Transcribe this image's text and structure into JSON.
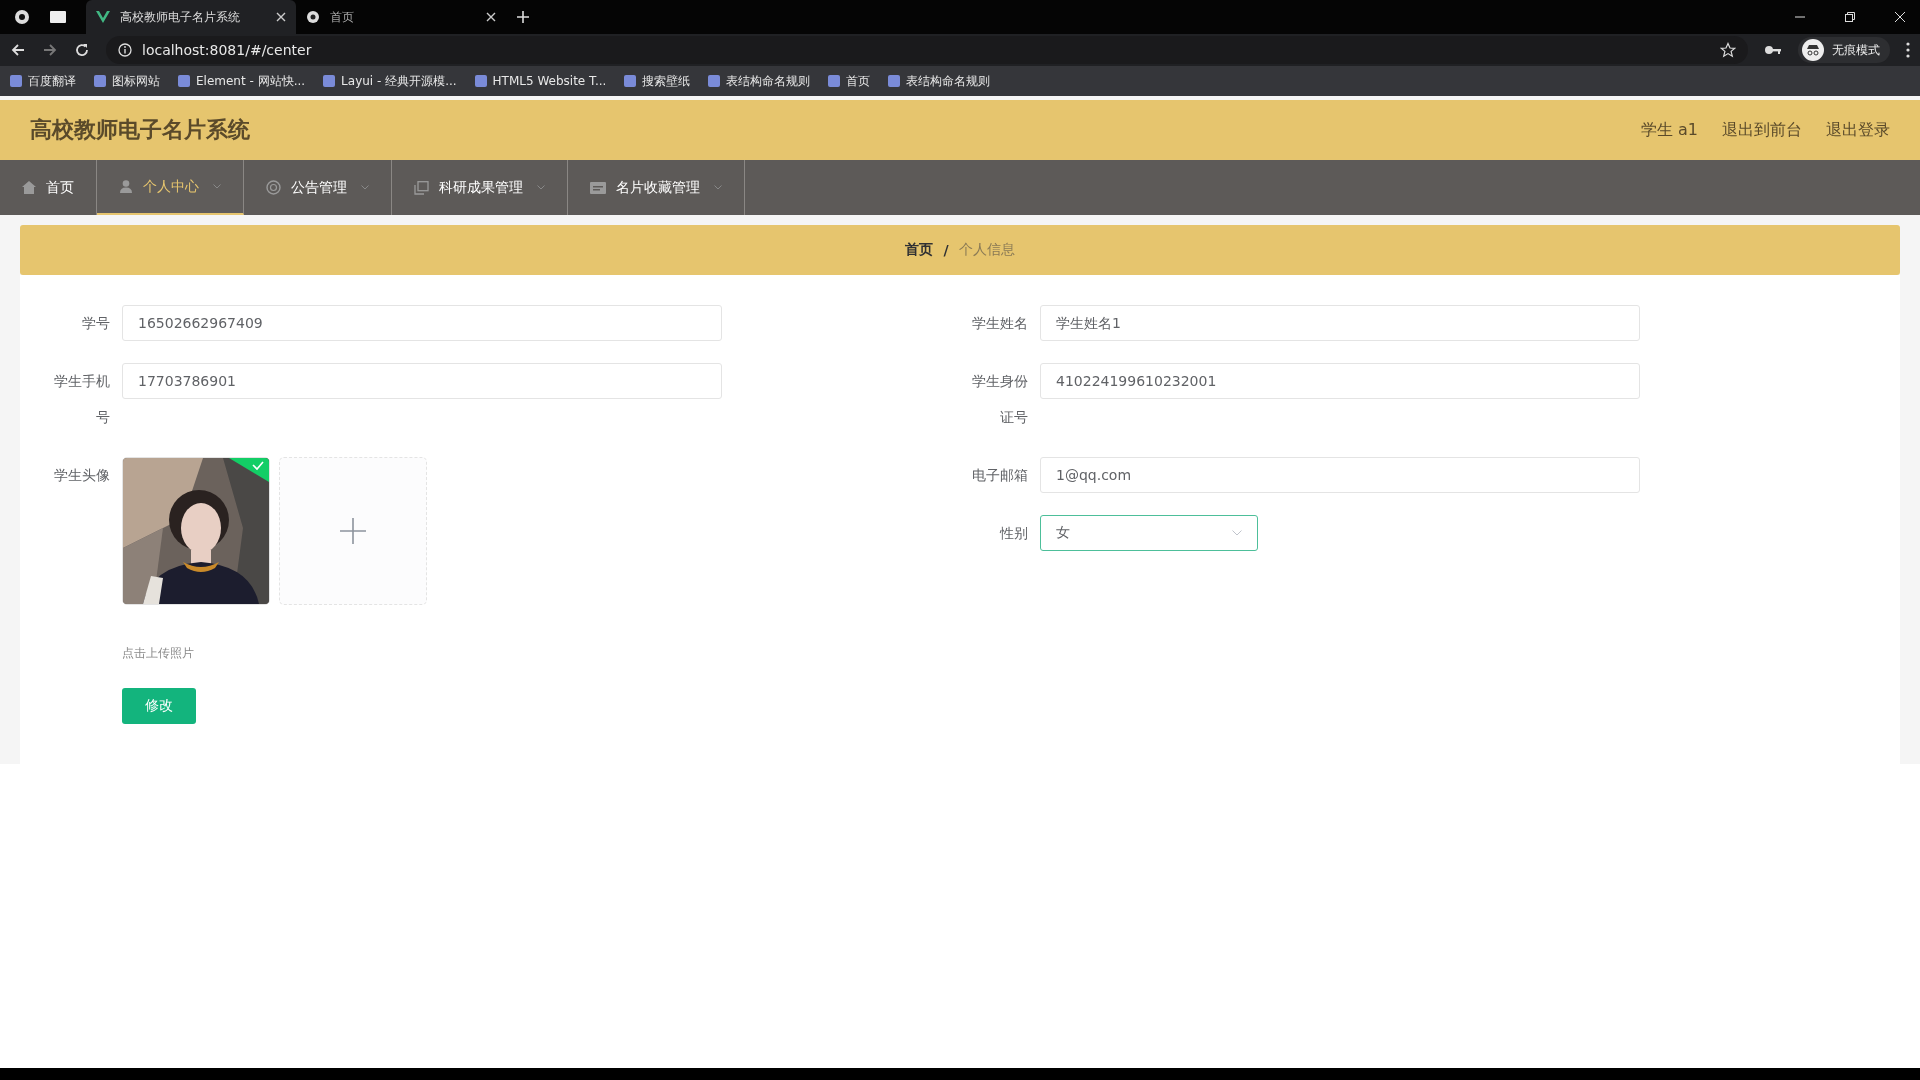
{
  "browser": {
    "tabs": [
      {
        "title": "高校教师电子名片系统",
        "selected": true
      },
      {
        "title": "首页",
        "selected": false
      }
    ],
    "url": "localhost:8081/#/center",
    "incognito_label": "无痕模式",
    "bookmarks": [
      "百度翻译",
      "图标网站",
      "Element - 网站快...",
      "Layui - 经典开源模...",
      "HTML5 Website T...",
      "搜索壁纸",
      "表结构命名规则",
      "首页",
      "表结构命名规则"
    ]
  },
  "header": {
    "title": "高校教师电子名片系统",
    "links": [
      "学生 a1",
      "退出到前台",
      "退出登录"
    ]
  },
  "nav": [
    {
      "label": "首页",
      "selected": false,
      "dropdown": false
    },
    {
      "label": "个人中心",
      "selected": true,
      "dropdown": true
    },
    {
      "label": "公告管理",
      "selected": false,
      "dropdown": true
    },
    {
      "label": "科研成果管理",
      "selected": false,
      "dropdown": true
    },
    {
      "label": "名片收藏管理",
      "selected": false,
      "dropdown": true
    }
  ],
  "breadcrumb_separator": "/",
  "breadcrumb": [
    {
      "label": "首页",
      "selected": false
    },
    {
      "label": "个人信息",
      "selected": true
    }
  ],
  "form": {
    "left": [
      {
        "kind": "input",
        "label": "学号",
        "value": "16502662967409"
      },
      {
        "kind": "input",
        "label": "学生手机号",
        "value": "17703786901"
      },
      {
        "kind": "upload",
        "label": "学生头像",
        "hint": "点击上传照片",
        "uploaded": true
      }
    ],
    "right": [
      {
        "kind": "input",
        "label": "学生姓名",
        "value": "学生姓名1"
      },
      {
        "kind": "input",
        "label": "学生身份证号",
        "value": "410224199610232001"
      },
      {
        "kind": "input",
        "label": "电子邮箱",
        "value": "1@qq.com"
      },
      {
        "kind": "select",
        "label": "性别",
        "value": "女"
      }
    ],
    "submit": "修改"
  }
}
